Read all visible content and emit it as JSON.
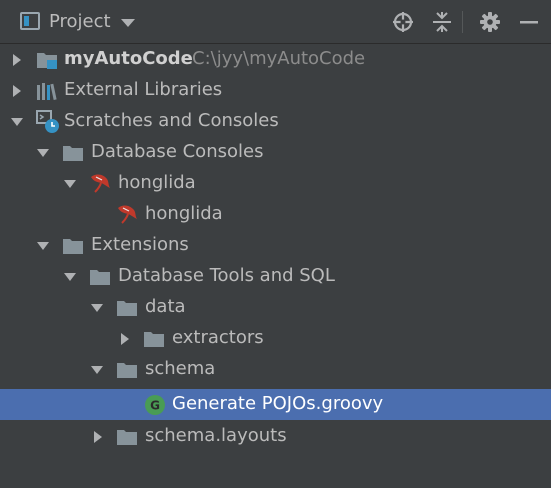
{
  "header": {
    "title": "Project",
    "icons": [
      "project-view-icon",
      "dropdown-caret-icon",
      "locate-icon",
      "collapse-all-icon",
      "settings-gear-icon",
      "hide-minus-icon"
    ]
  },
  "tree": {
    "items": [
      {
        "label": "myAutoCode",
        "path": "C:\\jyy\\myAutoCode",
        "icon": "module-folder-icon",
        "expanded": false,
        "selected": false
      },
      {
        "label": "External Libraries",
        "icon": "library-icon",
        "expanded": false,
        "selected": false
      },
      {
        "label": "Scratches and Consoles",
        "icon": "scratches-icon",
        "expanded": true,
        "selected": false
      },
      {
        "label": "Database Consoles",
        "icon": "folder-icon",
        "expanded": true,
        "selected": false
      },
      {
        "label": "honglida",
        "icon": "mysql-icon",
        "expanded": true,
        "selected": false
      },
      {
        "label": "honglida",
        "icon": "mysql-icon",
        "expanded": false,
        "selected": false
      },
      {
        "label": "Extensions",
        "icon": "folder-icon",
        "expanded": true,
        "selected": false
      },
      {
        "label": "Database Tools and SQL",
        "icon": "folder-icon",
        "expanded": true,
        "selected": false
      },
      {
        "label": "data",
        "icon": "folder-icon",
        "expanded": true,
        "selected": false
      },
      {
        "label": "extractors",
        "icon": "folder-icon",
        "expanded": false,
        "selected": false
      },
      {
        "label": "schema",
        "icon": "folder-icon",
        "expanded": true,
        "selected": false
      },
      {
        "label": "Generate POJOs.groovy",
        "icon": "groovy-file-icon",
        "expanded": false,
        "selected": true
      },
      {
        "label": "schema.layouts",
        "icon": "folder-icon",
        "expanded": false,
        "selected": false
      }
    ]
  },
  "colors": {
    "background": "#3c3f41",
    "selection": "#4b6eaf",
    "text": "#bbbbbb",
    "folder": "#87939a",
    "accent_blue": "#3592c4",
    "groovy_green": "#499c54",
    "mysql_red": "#c0392b"
  }
}
